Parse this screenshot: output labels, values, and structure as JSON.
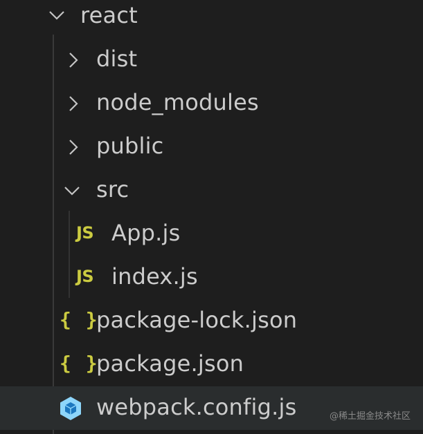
{
  "explorer": {
    "root": {
      "label": "react",
      "expanded": true
    },
    "items": [
      {
        "label": "dist",
        "type": "folder",
        "expanded": false
      },
      {
        "label": "node_modules",
        "type": "folder",
        "expanded": false
      },
      {
        "label": "public",
        "type": "folder",
        "expanded": false
      },
      {
        "label": "src",
        "type": "folder",
        "expanded": true
      },
      {
        "label": "App.js",
        "type": "js-file"
      },
      {
        "label": "index.js",
        "type": "js-file"
      },
      {
        "label": "package-lock.json",
        "type": "json-file"
      },
      {
        "label": "package.json",
        "type": "json-file"
      },
      {
        "label": "webpack.config.js",
        "type": "webpack-file",
        "selected": true
      }
    ],
    "icons": {
      "js": "JS",
      "json": "{ }"
    }
  },
  "watermark": "@稀土掘金技术社区",
  "colors": {
    "background": "#1e1e1e",
    "text": "#cccccc",
    "js_icon": "#cbcb41",
    "json_icon": "#cbcb41",
    "webpack_icon": "#8ed6fb",
    "selected_row": "#2a2d2e",
    "indent_guide": "#3a3a3a"
  }
}
